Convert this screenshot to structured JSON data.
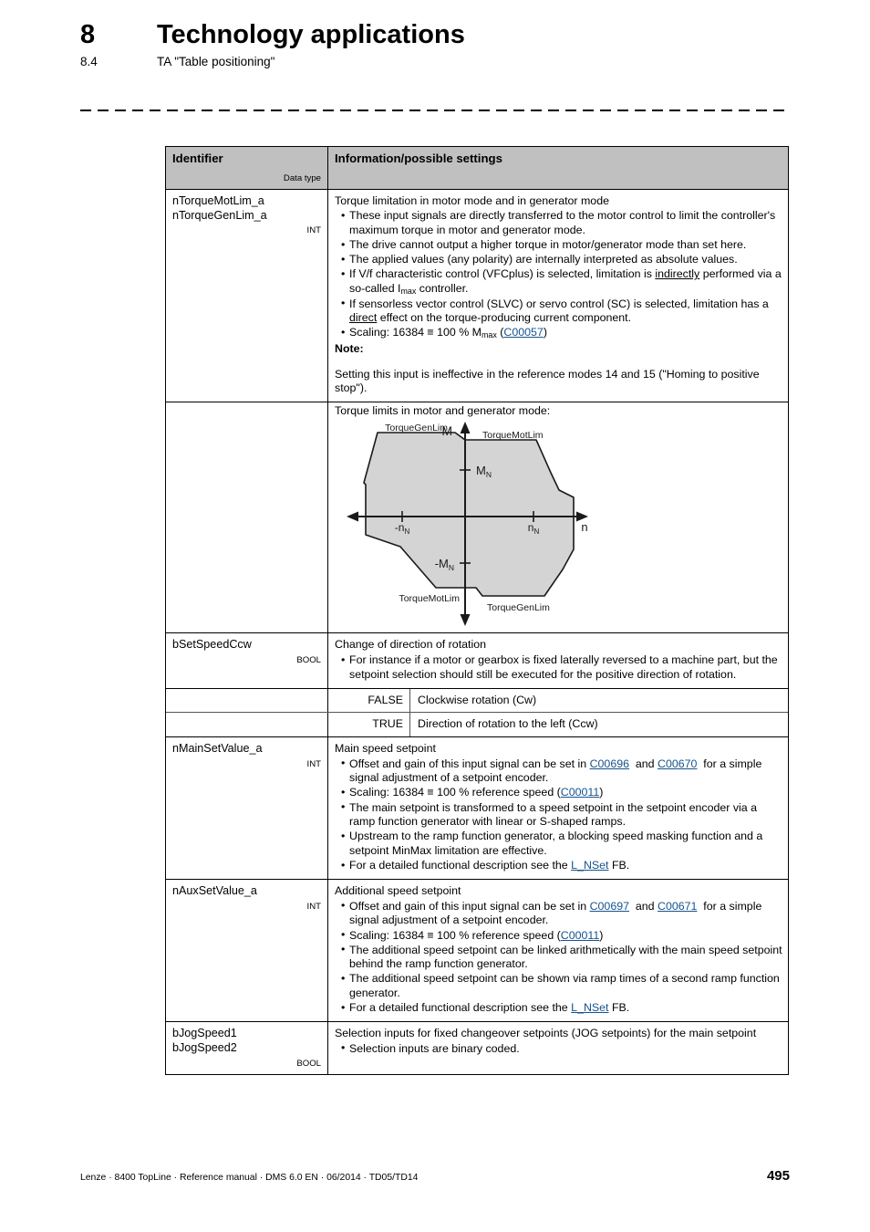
{
  "header": {
    "chapter_number": "8",
    "chapter_title": "Technology applications",
    "section_number": "8.4",
    "section_title": "TA \"Table positioning\""
  },
  "table": {
    "columns": {
      "identifier": "Identifier",
      "data_type": "Data type",
      "information": "Information/possible settings"
    },
    "rows": [
      {
        "identifier_1": "nTorqueMotLim_a",
        "identifier_2": "nTorqueGenLim_a",
        "data_type": "INT",
        "lead": "Torque limitation in motor mode and in generator mode",
        "bullets": [
          "These input signals are directly transferred to the motor control to limit the controller's maximum torque in motor and generator mode.",
          "The drive cannot output a higher torque in motor/generator mode than set here.",
          "The applied values (any polarity) are internally interpreted as absolute values.",
          "If V/f characteristic control (VFCplus) is selected, limitation is indirectly performed via a so-called Imax controller.",
          "If sensorless vector control (SLVC) or servo control (SC) is selected, limitation has a direct effect on the torque-producing current component.",
          "Scaling: 16384 ≡ 100 % Mmax (C00057)"
        ],
        "note_heading": "Note:",
        "note_body": "Setting this input is ineffective in the reference modes 14 and 15 (\"Homing to positive stop\")."
      },
      {
        "identifier_1": "bSetSpeedCcw",
        "data_type": "BOOL",
        "lead": "Change of direction of rotation",
        "bullets": [
          "For instance if a motor or gearbox is fixed laterally reversed to a machine part, but the setpoint selection should still be executed for the positive direction of rotation."
        ],
        "options": [
          {
            "key": "FALSE",
            "value": "Clockwise rotation (Cw)"
          },
          {
            "key": "TRUE",
            "value": "Direction of rotation to the left (Ccw)"
          }
        ]
      },
      {
        "identifier_1": "nMainSetValue_a",
        "data_type": "INT",
        "lead": "Main speed setpoint",
        "bullets": [
          "Offset and gain of this input signal can be set in C00696 and C00670 for a simple signal adjustment of a setpoint encoder.",
          "Scaling: 16384 ≡ 100 % reference speed (C00011)",
          "The main setpoint is transformed to a speed setpoint in the setpoint encoder via a ramp function generator with linear or S-shaped ramps.",
          "Upstream to the ramp function generator, a blocking speed masking function and a setpoint MinMax limitation are effective.",
          "For a detailed functional description see the L_NSet FB."
        ],
        "links": [
          "C00696",
          "C00670",
          "C00011",
          "L_NSet"
        ]
      },
      {
        "identifier_1": "nAuxSetValue_a",
        "data_type": "INT",
        "lead": "Additional speed setpoint",
        "bullets": [
          "Offset and gain of this input signal can be set in C00697 and C00671 for a simple signal adjustment of a setpoint encoder.",
          "Scaling: 16384 ≡ 100 % reference speed (C00011)",
          "The additional speed setpoint can be linked arithmetically with the main speed setpoint behind the ramp function generator.",
          "The additional speed setpoint can be shown via ramp times of a second ramp function generator.",
          "For a detailed functional description see the L_NSet FB."
        ],
        "links": [
          "C00697",
          "C00671",
          "C00011",
          "L_NSet"
        ]
      },
      {
        "identifier_1": "bJogSpeed1",
        "identifier_2": "bJogSpeed2",
        "data_type": "BOOL",
        "lead": "Selection inputs for fixed changeover setpoints (JOG setpoints) for the main setpoint",
        "bullets": [
          "Selection inputs are binary coded."
        ]
      }
    ]
  },
  "diagram": {
    "title": "Torque limits in motor and generator mode:",
    "axis_y_label": "M",
    "axis_x_label": "n",
    "ticks": {
      "m_nominal": "MN",
      "m_nominal_neg": "-MN",
      "n_nominal": "nN",
      "n_nominal_neg": "-nN"
    },
    "labels": {
      "top_left": "TorqueGenLim",
      "top_right": "TorqueMotLim",
      "bottom_left": "TorqueMotLim",
      "bottom_right": "TorqueGenLim"
    },
    "fill_color": "#d4d4d4",
    "stroke_color": "#1a1a1a"
  },
  "footer": {
    "text": "Lenze · 8400 TopLine · Reference manual · DMS 6.0 EN · 06/2014 · TD05/TD14",
    "page": "495"
  },
  "colors": {
    "link": "#15538f",
    "header_bg": "#c0c0c0",
    "border": "#000000"
  }
}
